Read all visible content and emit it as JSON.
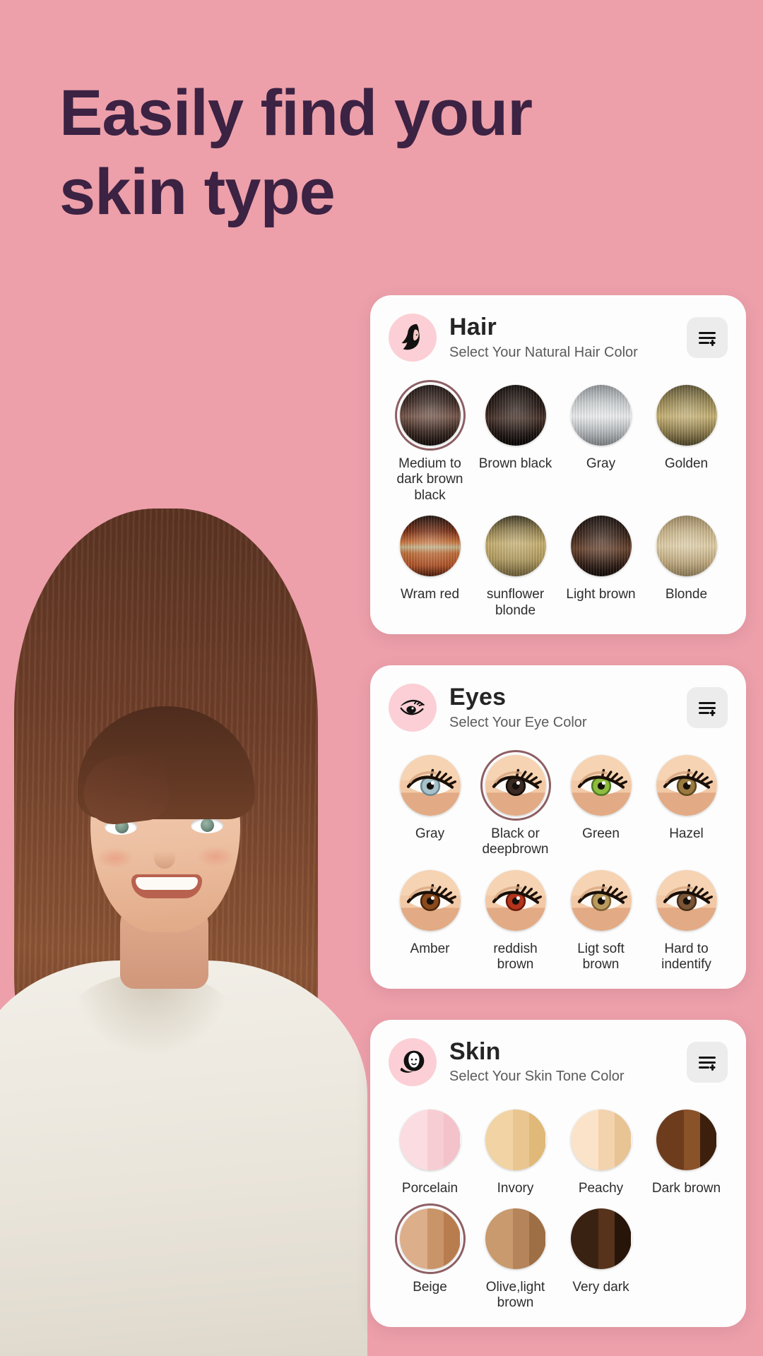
{
  "theme": {
    "background": "#eda0aa",
    "headline_color": "#3c2243",
    "card_background": "#fdfdfd",
    "avatar_background": "#fbcfd5",
    "selection_ring": "#8d5f64",
    "button_background": "#ececec"
  },
  "headline": {
    "line1": "Easily find your",
    "line2": "skin type"
  },
  "cards": [
    {
      "id": "hair",
      "icon": "woman-long-hair-icon",
      "title": "Hair",
      "subtitle": "Select Your Natural Hair Color",
      "action_icon": "list-add-icon",
      "options": [
        {
          "label": "Medium to dark brown black",
          "selected": true,
          "kind": "hair",
          "css": "linear-gradient(180deg,#1d1210 0%,#3d2a24 28%,#7a5a4e 52%,#3a2821 76%,#140d0b 100%)"
        },
        {
          "label": "Brown black",
          "selected": false,
          "kind": "hair",
          "css": "linear-gradient(180deg,#120c0a 0%,#2a1c17 35%,#4a342c 55%,#1d1411 80%,#0a0706 100%)"
        },
        {
          "label": "Gray",
          "selected": false,
          "kind": "hair",
          "css": "linear-gradient(180deg,#8e9295 0%,#cfd3d5 30%,#f2f4f5 52%,#bcc0c3 75%,#7d8184 100%)"
        },
        {
          "label": "Golden",
          "selected": false,
          "kind": "hair",
          "css": "linear-gradient(180deg,#5e5433 0%,#9c8b55 28%,#cdb87a 52%,#8d7c4c 78%,#4c4329 100%)"
        },
        {
          "label": "Wram red",
          "selected": false,
          "kind": "hair",
          "css": "linear-gradient(180deg,#1b0f0a 0%,#7b2f14 26%,#cf7840 44%,#c9b68c 52%,#c4713c 62%,#b2552a 82%,#4a1c0d 100%)"
        },
        {
          "label": "sunflower blonde",
          "selected": false,
          "kind": "hair",
          "css": "linear-gradient(180deg,#3b3421 0%,#8e7c4b 22%,#ccb574 46%,#b59f62 72%,#6b5d38 100%)"
        },
        {
          "label": "Light brown",
          "selected": false,
          "kind": "hair",
          "css": "linear-gradient(180deg,#170e0b 0%,#3a2419 32%,#6b4530 55%,#2e1c14 82%,#120b08 100%)"
        },
        {
          "label": "Blonde",
          "selected": false,
          "kind": "hair",
          "css": "linear-gradient(180deg,#9b8560 0%,#cdb88c 26%,#e6d5ad 50%,#c6af83 76%,#8d7a57 100%)"
        }
      ]
    },
    {
      "id": "eyes",
      "icon": "eye-lash-icon",
      "title": "Eyes",
      "subtitle": "Select Your Eye Color",
      "action_icon": "list-add-icon",
      "options": [
        {
          "label": "Gray",
          "selected": false,
          "kind": "eye",
          "iris": "#a8c2cb",
          "iris_dark": "#6d8a93"
        },
        {
          "label": "Black or deepbrown",
          "selected": true,
          "kind": "eye",
          "iris": "#3a2a22",
          "iris_dark": "#140d09"
        },
        {
          "label": "Green",
          "selected": false,
          "kind": "eye",
          "iris": "#8ebc3f",
          "iris_dark": "#4e7a22"
        },
        {
          "label": "Hazel",
          "selected": false,
          "kind": "eye",
          "iris": "#9a7a3f",
          "iris_dark": "#5d4720"
        },
        {
          "label": "Amber",
          "selected": false,
          "kind": "eye",
          "iris": "#8a4a1c",
          "iris_dark": "#4d2609"
        },
        {
          "label": "reddish brown",
          "selected": false,
          "kind": "eye",
          "iris": "#b3341c",
          "iris_dark": "#6d1a0a"
        },
        {
          "label": "Ligt soft brown",
          "selected": false,
          "kind": "eye",
          "iris": "#b99a5e",
          "iris_dark": "#7b6033"
        },
        {
          "label": "Hard to indentify",
          "selected": false,
          "kind": "eye",
          "iris": "#7a5436",
          "iris_dark": "#4a2f18"
        }
      ]
    },
    {
      "id": "skin",
      "icon": "woman-face-icon",
      "title": "Skin",
      "subtitle": "Select Your Skin Tone Color",
      "action_icon": "list-add-icon",
      "options": [
        {
          "label": "Porcelain",
          "selected": false,
          "kind": "skin",
          "tones": [
            "#fbdce0",
            "#f7cdd4",
            "#f3c2ca"
          ]
        },
        {
          "label": "Invory",
          "selected": false,
          "kind": "skin",
          "tones": [
            "#f2d3a3",
            "#e9c58f",
            "#e0b878"
          ]
        },
        {
          "label": "Peachy",
          "selected": false,
          "kind": "skin",
          "tones": [
            "#fae3c9",
            "#f2d3ae",
            "#e8c394"
          ]
        },
        {
          "label": "Dark brown",
          "selected": false,
          "kind": "skin",
          "tones": [
            "#6d3c1d",
            "#8a5229",
            "#3d1f0d"
          ]
        },
        {
          "label": "Beige",
          "selected": true,
          "kind": "skin",
          "tones": [
            "#dcae8a",
            "#c99468",
            "#b87d4f"
          ]
        },
        {
          "label": "Olive,light brown",
          "selected": false,
          "kind": "skin",
          "tones": [
            "#c89a6d",
            "#b5845a",
            "#9e6e45"
          ]
        },
        {
          "label": "Very dark",
          "selected": false,
          "kind": "skin",
          "tones": [
            "#3a2213",
            "#57331c",
            "#27150a"
          ]
        }
      ]
    }
  ]
}
